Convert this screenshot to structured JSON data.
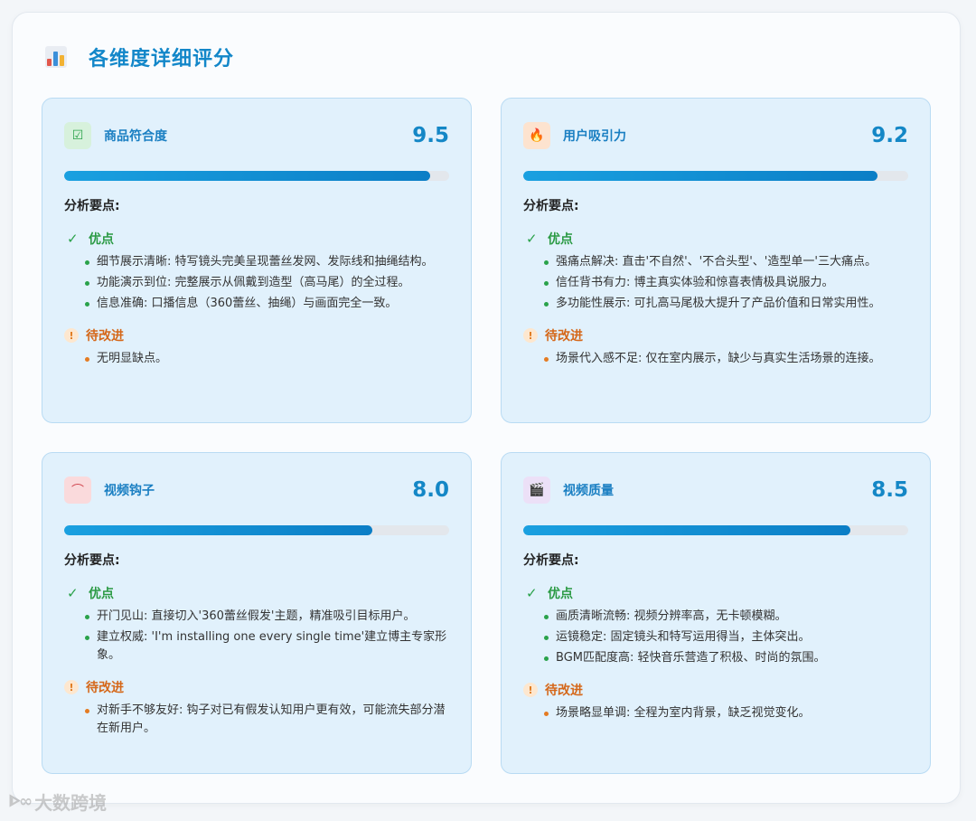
{
  "header": {
    "title": "各维度详细评分",
    "icon": "bar-chart-icon"
  },
  "cards": [
    {
      "title": "商品符合度",
      "score": "9.5",
      "score_value": 9.5,
      "icon": "check-box-icon",
      "icon_glyph": "☑",
      "icon_bg": "#d7f1dc",
      "icon_color": "#2aa24a",
      "analysis_label": "分析要点:",
      "pros_title": "优点",
      "pros": [
        "细节展示清晰: 特写镜头完美呈现蕾丝发网、发际线和抽绳结构。",
        "功能演示到位: 完整展示从佩戴到造型（高马尾）的全过程。",
        "信息准确: 口播信息（360蕾丝、抽绳）与画面完全一致。"
      ],
      "cons_title": "待改进",
      "cons": [
        "无明显缺点。"
      ]
    },
    {
      "title": "用户吸引力",
      "score": "9.2",
      "score_value": 9.2,
      "icon": "fire-icon",
      "icon_glyph": "🔥",
      "icon_bg": "#fde3cf",
      "icon_color": "#e4602a",
      "analysis_label": "分析要点:",
      "pros_title": "优点",
      "pros": [
        "强痛点解决: 直击'不自然'、'不合头型'、'造型单一'三大痛点。",
        "信任背书有力: 博主真实体验和惊喜表情极具说服力。",
        "多功能性展示: 可扎高马尾极大提升了产品价值和日常实用性。"
      ],
      "cons_title": "待改进",
      "cons": [
        "场景代入感不足: 仅在室内展示，缺少与真实生活场景的连接。"
      ]
    },
    {
      "title": "视频钩子",
      "score": "8.0",
      "score_value": 8.0,
      "icon": "hook-icon",
      "icon_glyph": "⌒",
      "icon_bg": "#fadadc",
      "icon_color": "#d0454e",
      "analysis_label": "分析要点:",
      "pros_title": "优点",
      "pros": [
        "开门见山: 直接切入'360蕾丝假发'主题，精准吸引目标用户。",
        "建立权威: 'I'm installing one every single time'建立博主专家形象。"
      ],
      "cons_title": "待改进",
      "cons": [
        "对新手不够友好: 钩子对已有假发认知用户更有效，可能流失部分潜在新用户。"
      ]
    },
    {
      "title": "视频质量",
      "score": "8.5",
      "score_value": 8.5,
      "icon": "clapperboard-icon",
      "icon_glyph": "🎬",
      "icon_bg": "#ece0f7",
      "icon_color": "#7b4fb0",
      "analysis_label": "分析要点:",
      "pros_title": "优点",
      "pros": [
        "画质清晰流畅: 视频分辨率高，无卡顿模糊。",
        "运镜稳定: 固定镜头和特写运用得当，主体突出。",
        "BGM匹配度高: 轻快音乐营造了积极、时尚的氛围。"
      ],
      "cons_title": "待改进",
      "cons": [
        "场景略显单调: 全程为室内背景，缺乏视觉变化。"
      ]
    }
  ],
  "watermark": {
    "text": "大数跨境",
    "icon": "watermark-logo-icon"
  }
}
